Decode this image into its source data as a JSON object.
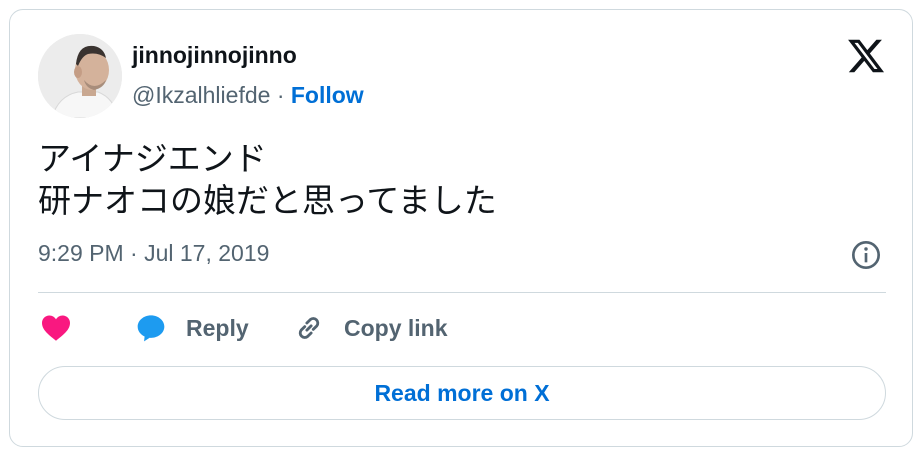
{
  "author": {
    "display_name": "jinnojinnojinno",
    "handle": "@Ikzalhliefde",
    "separator": "·",
    "follow_label": "Follow"
  },
  "tweet": {
    "lines": [
      "アイナジエンド",
      "研ナオコの娘だと思ってました"
    ],
    "timestamp": "9:29 PM · Jul 17, 2019"
  },
  "actions": {
    "like_icon": "heart-icon",
    "reply_label": "Reply",
    "copy_link_label": "Copy link"
  },
  "read_more_label": "Read more on X",
  "colors": {
    "text_primary": "#0f1419",
    "text_secondary": "#536471",
    "link_blue": "#006fd6",
    "like_pink": "#f91880",
    "reply_blue": "#1d9bf0",
    "border": "#cfd9de"
  }
}
